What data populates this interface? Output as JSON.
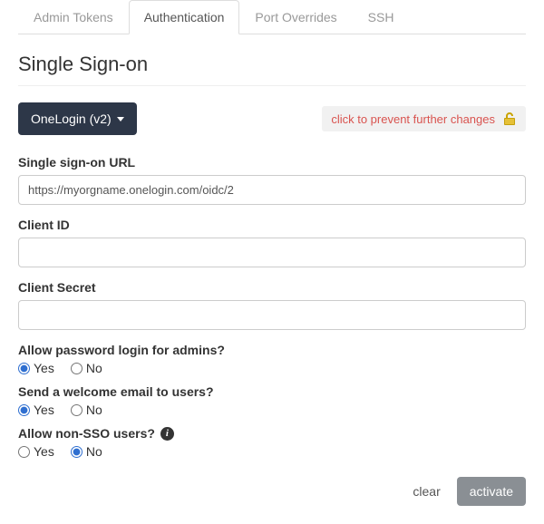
{
  "tabs": {
    "admin_tokens": "Admin Tokens",
    "authentication": "Authentication",
    "port_overrides": "Port Overrides",
    "ssh": "SSH"
  },
  "section_title": "Single Sign-on",
  "provider_dropdown_label": "OneLogin (v2)",
  "lock_text": "click to prevent further changes",
  "fields": {
    "sso_url": {
      "label": "Single sign-on URL",
      "value": "https://myorgname.onelogin.com/oidc/2"
    },
    "client_id": {
      "label": "Client ID",
      "value": ""
    },
    "client_secret": {
      "label": "Client Secret",
      "value": ""
    }
  },
  "questions": {
    "password_login": {
      "label": "Allow password login for admins?",
      "value": "yes"
    },
    "welcome_email": {
      "label": "Send a welcome email to users?",
      "value": "yes"
    },
    "non_sso": {
      "label": "Allow non-SSO users?",
      "value": "no"
    }
  },
  "options": {
    "yes": "Yes",
    "no": "No"
  },
  "actions": {
    "clear": "clear",
    "activate": "activate"
  }
}
